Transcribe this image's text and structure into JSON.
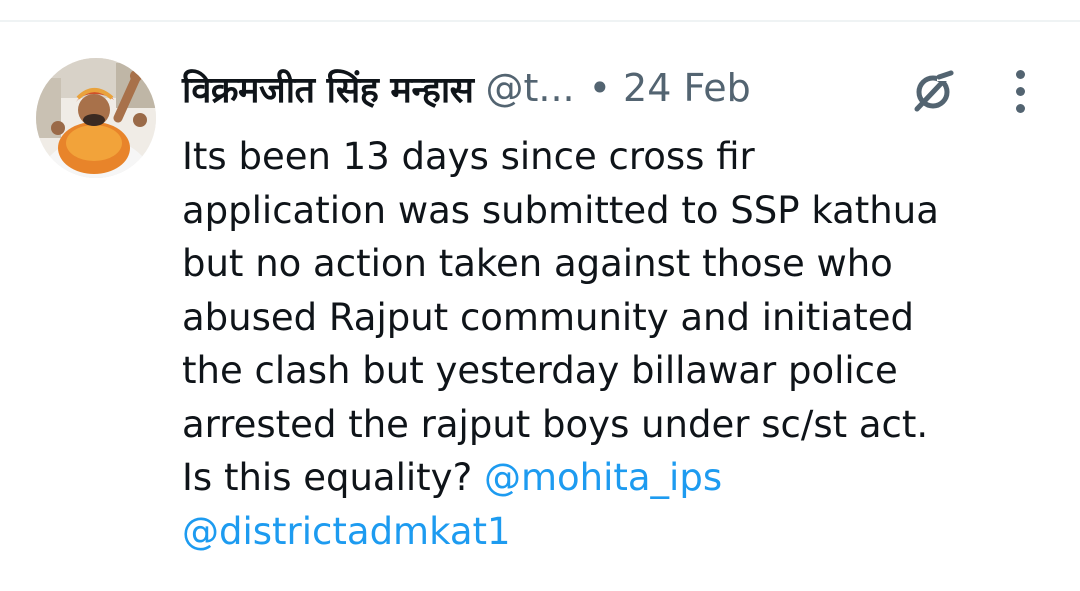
{
  "tweet": {
    "display_name": "विक्रमजीत सिंह मन्हास",
    "handle": "@t...",
    "separator": "•",
    "date": "24 Feb",
    "grok_icon": "grok-icon",
    "more_icon": "more-icon",
    "body_lines": [
      "Its been 13 days since cross fir",
      "application was submitted to SSP kathua",
      "but no action taken against those who",
      "abused Rajput community and initiated",
      "the clash but yesterday billawar police",
      "arrested the rajput boys under sc/st act.",
      "Is this equality?"
    ],
    "mention_1": "@mohita_ips",
    "mention_2": "@districtadmkat1"
  },
  "colors": {
    "text": "#0f1419",
    "secondary": "#536471",
    "link": "#1d9bf0",
    "divider": "#eff3f4"
  }
}
